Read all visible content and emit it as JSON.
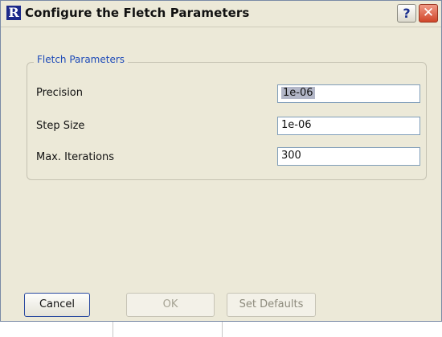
{
  "window": {
    "title": "Configure the Fletch Parameters",
    "app_icon_letter": "R",
    "help_label": "?",
    "close_label": "✕"
  },
  "group": {
    "legend": "Fletch Parameters",
    "fields": [
      {
        "label": "Precision",
        "value": "1e-06"
      },
      {
        "label": "Step Size",
        "value": "1e-06"
      },
      {
        "label": "Max. Iterations",
        "value": "300"
      }
    ]
  },
  "buttons": {
    "cancel": "Cancel",
    "ok": "OK",
    "set_defaults": "Set Defaults"
  },
  "colors": {
    "window_bg": "#ece9d8",
    "legend_text": "#1d4ab8",
    "close_red": "#d0462a"
  }
}
